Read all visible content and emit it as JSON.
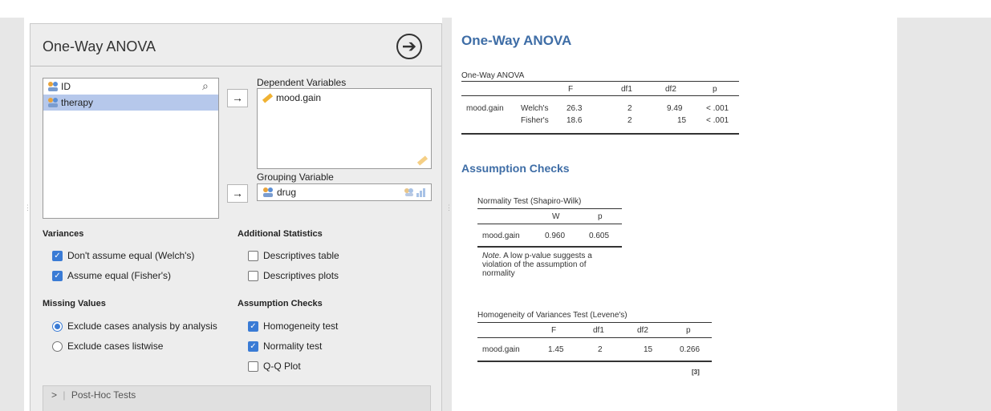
{
  "panel": {
    "title": "One-Way ANOVA",
    "variables": [
      {
        "name": "ID",
        "icon": "id-icon"
      },
      {
        "name": "therapy",
        "icon": "nominal-text-icon"
      }
    ],
    "dependent_label": "Dependent Variables",
    "dependent_vars": [
      "mood.gain"
    ],
    "grouping_label": "Grouping Variable",
    "grouping_var": "drug",
    "variances": {
      "title": "Variances",
      "options": [
        {
          "label": "Don't assume equal (Welch's)",
          "checked": true
        },
        {
          "label": "Assume equal (Fisher's)",
          "checked": true
        }
      ]
    },
    "additional": {
      "title": "Additional Statistics",
      "options": [
        {
          "label": "Descriptives table",
          "checked": false
        },
        {
          "label": "Descriptives plots",
          "checked": false
        }
      ]
    },
    "missing": {
      "title": "Missing Values",
      "options": [
        {
          "label": "Exclude cases analysis by analysis",
          "selected": true
        },
        {
          "label": "Exclude cases listwise",
          "selected": false
        }
      ]
    },
    "assumption": {
      "title": "Assumption Checks",
      "options": [
        {
          "label": "Homogeneity test",
          "checked": true
        },
        {
          "label": "Normality test",
          "checked": true
        },
        {
          "label": "Q-Q Plot",
          "checked": false
        }
      ]
    },
    "posthoc_label": "Post-Hoc Tests",
    "accent": "#3a7bd5"
  },
  "results": {
    "title": "One-Way ANOVA",
    "anova_table": {
      "caption": "One-Way ANOVA",
      "headers": [
        "",
        "",
        "F",
        "df1",
        "df2",
        "p"
      ],
      "rows": [
        [
          "mood.gain",
          "Welch's",
          "26.3",
          "2",
          "9.49",
          "< .001"
        ],
        [
          "",
          "Fisher's",
          "18.6",
          "2",
          "15",
          "< .001"
        ]
      ]
    },
    "assumption_title": "Assumption Checks",
    "normality_table": {
      "caption": "Normality Test (Shapiro-Wilk)",
      "headers": [
        "",
        "W",
        "p"
      ],
      "rows": [
        [
          "mood.gain",
          "0.960",
          "0.605"
        ]
      ],
      "note_label": "Note.",
      "note_text": "A low p-value suggests a violation of the assumption of normality"
    },
    "levene_table": {
      "caption": "Homogeneity of Variances Test (Levene's)",
      "headers": [
        "",
        "F",
        "df1",
        "df2",
        "p"
      ],
      "rows": [
        [
          "mood.gain",
          "1.45",
          "2",
          "15",
          "0.266"
        ]
      ],
      "ref": "[3]"
    },
    "heading_color": "#3e6da6"
  }
}
